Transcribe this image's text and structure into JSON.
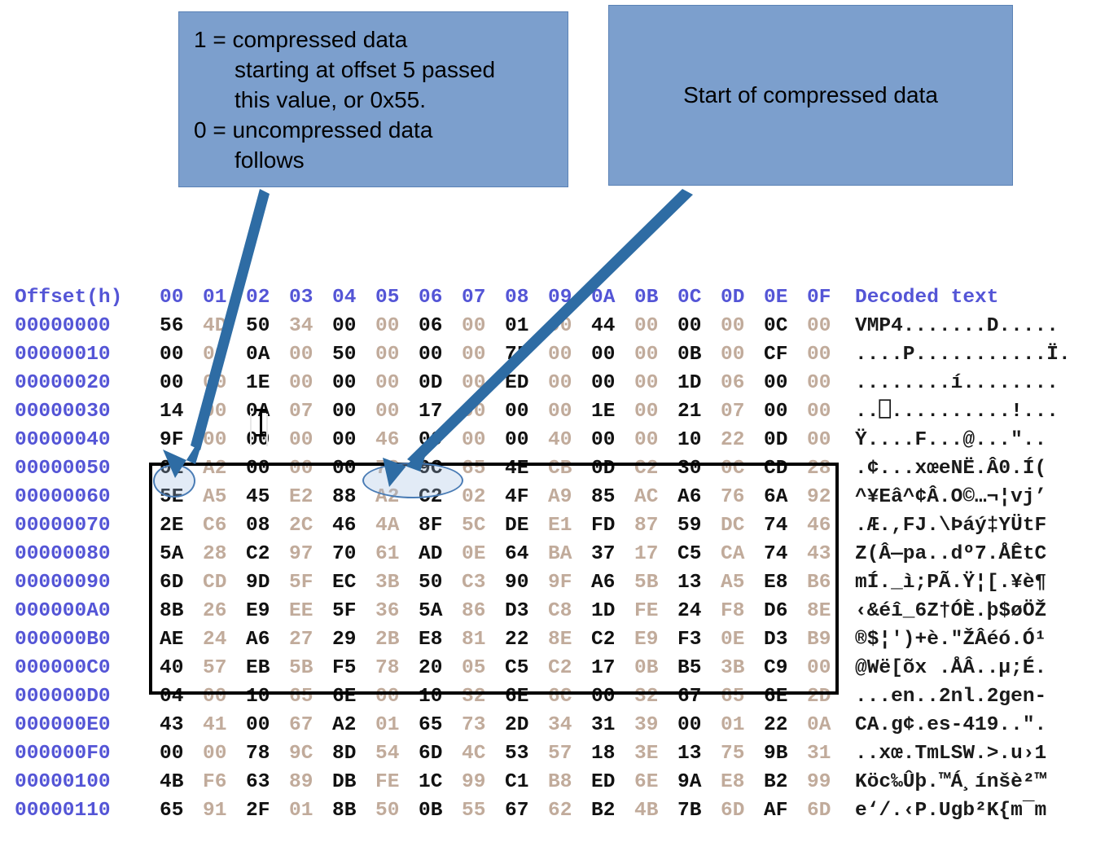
{
  "callouts": {
    "left": {
      "line1": "1 = compressed data",
      "line2": "starting at offset 5 passed",
      "line3": "this value, or 0x55.",
      "line4": "0 = uncompressed data",
      "line5": "follows",
      "fill_color": "#7c9fcd"
    },
    "right": {
      "text": "Start of compressed data",
      "fill_color": "#7c9fcd"
    }
  },
  "annotations": {
    "arrow_color": "#2e6ca4",
    "box_color": "#000000",
    "ellipse_color": "#4a7cb5",
    "left_arrow_target": "01",
    "right_arrow_target": "78 9C",
    "highlight_box_range": "00000050 - 000000C0"
  },
  "hexdump": {
    "header": {
      "offset_label": "Offset(h)",
      "columns": [
        "00",
        "01",
        "02",
        "03",
        "04",
        "05",
        "06",
        "07",
        "08",
        "09",
        "0A",
        "0B",
        "0C",
        "0D",
        "0E",
        "0F"
      ],
      "decoded_label": "Decoded text"
    },
    "rows": [
      {
        "offset": "00000000",
        "bytes": [
          "56",
          "4D",
          "50",
          "34",
          "00",
          "00",
          "06",
          "00",
          "01",
          "00",
          "44",
          "00",
          "00",
          "00",
          "0C",
          "00"
        ],
        "decoded": "VMP4.......D....."
      },
      {
        "offset": "00000010",
        "bytes": [
          "00",
          "00",
          "0A",
          "00",
          "50",
          "00",
          "00",
          "00",
          "7F",
          "00",
          "00",
          "00",
          "0B",
          "00",
          "CF",
          "00"
        ],
        "decoded": "....P...........Ï."
      },
      {
        "offset": "00000020",
        "bytes": [
          "00",
          "00",
          "1E",
          "00",
          "00",
          "00",
          "0D",
          "00",
          "ED",
          "00",
          "00",
          "00",
          "1D",
          "06",
          "00",
          "00"
        ],
        "decoded": "........í........"
      },
      {
        "offset": "00000030",
        "bytes": [
          "14",
          "00",
          "0A",
          "07",
          "00",
          "00",
          "17",
          "00",
          "00",
          "00",
          "1E",
          "00",
          "21",
          "07",
          "00",
          "00"
        ],
        "decoded": "..⎕..........!..."
      },
      {
        "offset": "00000040",
        "bytes": [
          "9F",
          "00",
          "00",
          "00",
          "00",
          "46",
          "00",
          "00",
          "00",
          "40",
          "00",
          "00",
          "10",
          "22",
          "0D",
          "00"
        ],
        "decoded": "Ÿ....F...@...\"..",
        "first_byte_obscured": true
      },
      {
        "offset": "00000050",
        "bytes": [
          "01",
          "A2",
          "00",
          "00",
          "00",
          "78",
          "9C",
          "65",
          "4E",
          "CB",
          "0D",
          "C2",
          "30",
          "0C",
          "CD",
          "28"
        ],
        "decoded": ".¢...xœeNË.Â0.Í("
      },
      {
        "offset": "00000060",
        "bytes": [
          "5E",
          "A5",
          "45",
          "E2",
          "88",
          "A2",
          "C2",
          "02",
          "4F",
          "A9",
          "85",
          "AC",
          "A6",
          "76",
          "6A",
          "92"
        ],
        "decoded": "^¥Eâ^¢Â.O©…¬¦vj’"
      },
      {
        "offset": "00000070",
        "bytes": [
          "2E",
          "C6",
          "08",
          "2C",
          "46",
          "4A",
          "8F",
          "5C",
          "DE",
          "E1",
          "FD",
          "87",
          "59",
          "DC",
          "74",
          "46"
        ],
        "decoded": ".Æ.,FJ.\\Þáý‡YÜtF"
      },
      {
        "offset": "00000080",
        "bytes": [
          "5A",
          "28",
          "C2",
          "97",
          "70",
          "61",
          "AD",
          "0E",
          "64",
          "BA",
          "37",
          "17",
          "C5",
          "CA",
          "74",
          "43"
        ],
        "decoded": "Z(Â—pa..dº7.ÅÊtC"
      },
      {
        "offset": "00000090",
        "bytes": [
          "6D",
          "CD",
          "9D",
          "5F",
          "EC",
          "3B",
          "50",
          "C3",
          "90",
          "9F",
          "A6",
          "5B",
          "13",
          "A5",
          "E8",
          "B6"
        ],
        "decoded": "mÍ._ì;PÃ.Ÿ¦[.¥è¶"
      },
      {
        "offset": "000000A0",
        "bytes": [
          "8B",
          "26",
          "E9",
          "EE",
          "5F",
          "36",
          "5A",
          "86",
          "D3",
          "C8",
          "1D",
          "FE",
          "24",
          "F8",
          "D6",
          "8E"
        ],
        "decoded": "‹&éî_6Z†ÓÈ.þ$øÖŽ"
      },
      {
        "offset": "000000B0",
        "bytes": [
          "AE",
          "24",
          "A6",
          "27",
          "29",
          "2B",
          "E8",
          "81",
          "22",
          "8E",
          "C2",
          "E9",
          "F3",
          "0E",
          "D3",
          "B9"
        ],
        "decoded": "®$¦')+è.\"ŽÂéó.Ó¹"
      },
      {
        "offset": "000000C0",
        "bytes": [
          "40",
          "57",
          "EB",
          "5B",
          "F5",
          "78",
          "20",
          "05",
          "C5",
          "C2",
          "17",
          "0B",
          "B5",
          "3B",
          "C9",
          "00"
        ],
        "decoded": "@Wë[õx .ÅÂ..µ;É."
      },
      {
        "offset": "000000D0",
        "bytes": [
          "04",
          "00",
          "10",
          "65",
          "6E",
          "00",
          "10",
          "32",
          "6E",
          "6C",
          "00",
          "32",
          "67",
          "65",
          "6E",
          "2D"
        ],
        "decoded": "...en..2nl.2gen-"
      },
      {
        "offset": "000000E0",
        "bytes": [
          "43",
          "41",
          "00",
          "67",
          "A2",
          "01",
          "65",
          "73",
          "2D",
          "34",
          "31",
          "39",
          "00",
          "01",
          "22",
          "0A"
        ],
        "decoded": "CA.g¢.es-419..\"."
      },
      {
        "offset": "000000F0",
        "bytes": [
          "00",
          "00",
          "78",
          "9C",
          "8D",
          "54",
          "6D",
          "4C",
          "53",
          "57",
          "18",
          "3E",
          "13",
          "75",
          "9B",
          "31"
        ],
        "decoded": "..xœ.TmLSW.>.u›1"
      },
      {
        "offset": "00000100",
        "bytes": [
          "4B",
          "F6",
          "63",
          "89",
          "DB",
          "FE",
          "1C",
          "99",
          "C1",
          "B8",
          "ED",
          "6E",
          "9A",
          "E8",
          "B2",
          "99"
        ],
        "decoded": "Köc‰Ûþ.™Á¸ínšè²™"
      },
      {
        "offset": "00000110",
        "bytes": [
          "65",
          "91",
          "2F",
          "01",
          "8B",
          "50",
          "0B",
          "55",
          "67",
          "62",
          "B2",
          "4B",
          "7B",
          "6D",
          "AF",
          "6D"
        ],
        "decoded": "e‘/.‹P.Ugb²K{m¯m"
      }
    ]
  }
}
